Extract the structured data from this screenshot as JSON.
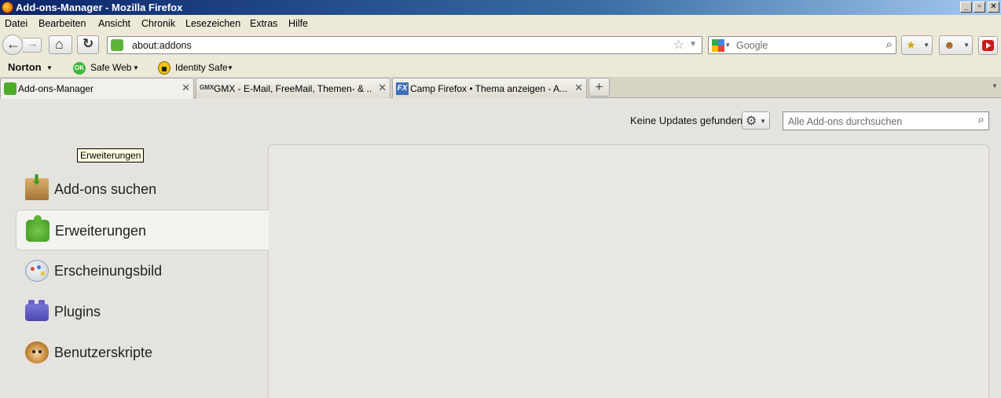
{
  "window": {
    "title": "Add-ons-Manager - Mozilla Firefox",
    "controls": [
      "_",
      "▫",
      "✕"
    ]
  },
  "menu": [
    "Datei",
    "Bearbeiten",
    "Ansicht",
    "Chronik",
    "Lesezeichen",
    "Extras",
    "Hilfe"
  ],
  "navbar": {
    "url": "about:addons",
    "search_placeholder": "Google"
  },
  "norton_bar": {
    "brand": "Norton",
    "safe_web_badge": "OK",
    "safe_web": "Safe Web",
    "identity_safe": "Identity Safe"
  },
  "tabs": [
    {
      "label": "Add-ons-Manager",
      "active": true,
      "icon": "puzzle-icon"
    },
    {
      "label": "GMX - E-Mail, FreeMail, Themen- & ...",
      "active": false,
      "icon": "gmx-icon",
      "icon_text": "GMX"
    },
    {
      "label": "Camp Firefox • Thema anzeigen - A...",
      "active": false,
      "icon": "fx-icon",
      "icon_text": "FX"
    }
  ],
  "addons": {
    "updates_status": "Keine Updates gefunden",
    "search_placeholder": "Alle Add-ons durchsuchen",
    "categories": [
      {
        "label": "Add-ons suchen",
        "icon": "install-icon"
      },
      {
        "label": "Erweiterungen",
        "icon": "extension-icon",
        "selected": true
      },
      {
        "label": "Erscheinungsbild",
        "icon": "appearance-icon"
      },
      {
        "label": "Plugins",
        "icon": "plugin-icon"
      },
      {
        "label": "Benutzerskripte",
        "icon": "greasemonkey-icon"
      }
    ],
    "tooltip": "Erweiterungen"
  },
  "colors": {
    "titlebar_start": "#0a246a",
    "titlebar_end": "#a6caf0",
    "chrome_bg": "#ece9d8",
    "content_bg": "#e5e3de"
  }
}
